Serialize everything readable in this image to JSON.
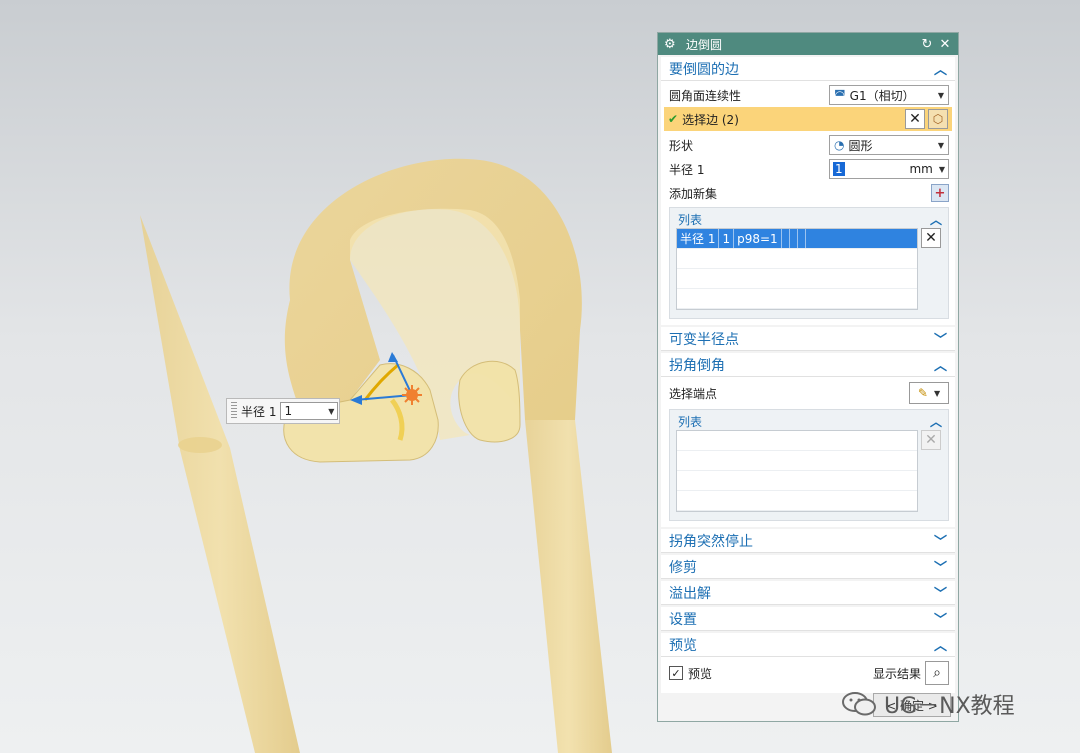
{
  "viewport": {
    "radius_tip": {
      "label": "半径 1",
      "value": "1"
    }
  },
  "dialog": {
    "title": "边倒圆",
    "edges_section": {
      "title": "要倒圆的边",
      "continuity_label": "圆角面连续性",
      "continuity_value": "G1（相切）",
      "select_edge_label": "选择边 (2)",
      "shape_label": "形状",
      "shape_value": "圆形",
      "radius_label": "半径 1",
      "radius_value": "1",
      "radius_unit": "mm",
      "add_new_set_label": "添加新集",
      "list_title": "列表",
      "list_rows": [
        {
          "name": "半径 1",
          "value": "1",
          "expr": "p98=1"
        }
      ]
    },
    "variable_radius_section": {
      "title": "可变半径点"
    },
    "corner_setback_section": {
      "title": "拐角倒角",
      "select_endpoint_label": "选择端点",
      "list_title": "列表"
    },
    "stop_short_section": {
      "title": "拐角突然停止"
    },
    "trim_section": {
      "title": "修剪"
    },
    "overflow_section": {
      "title": "溢出解"
    },
    "settings_section": {
      "title": "设置"
    },
    "preview_section": {
      "title": "预览",
      "preview_label": "预览",
      "preview_checked": true,
      "show_result_label": "显示结果"
    },
    "bottom_button_label": "< 确定 >"
  },
  "watermark": {
    "text": "UG－NX教程"
  },
  "colors": {
    "titlebar": "#4f8a7f",
    "section_title": "#1c6fb3",
    "select_highlight": "#fbd47a",
    "list_selected": "#2f83e0",
    "part_fill": "#f0d890"
  }
}
